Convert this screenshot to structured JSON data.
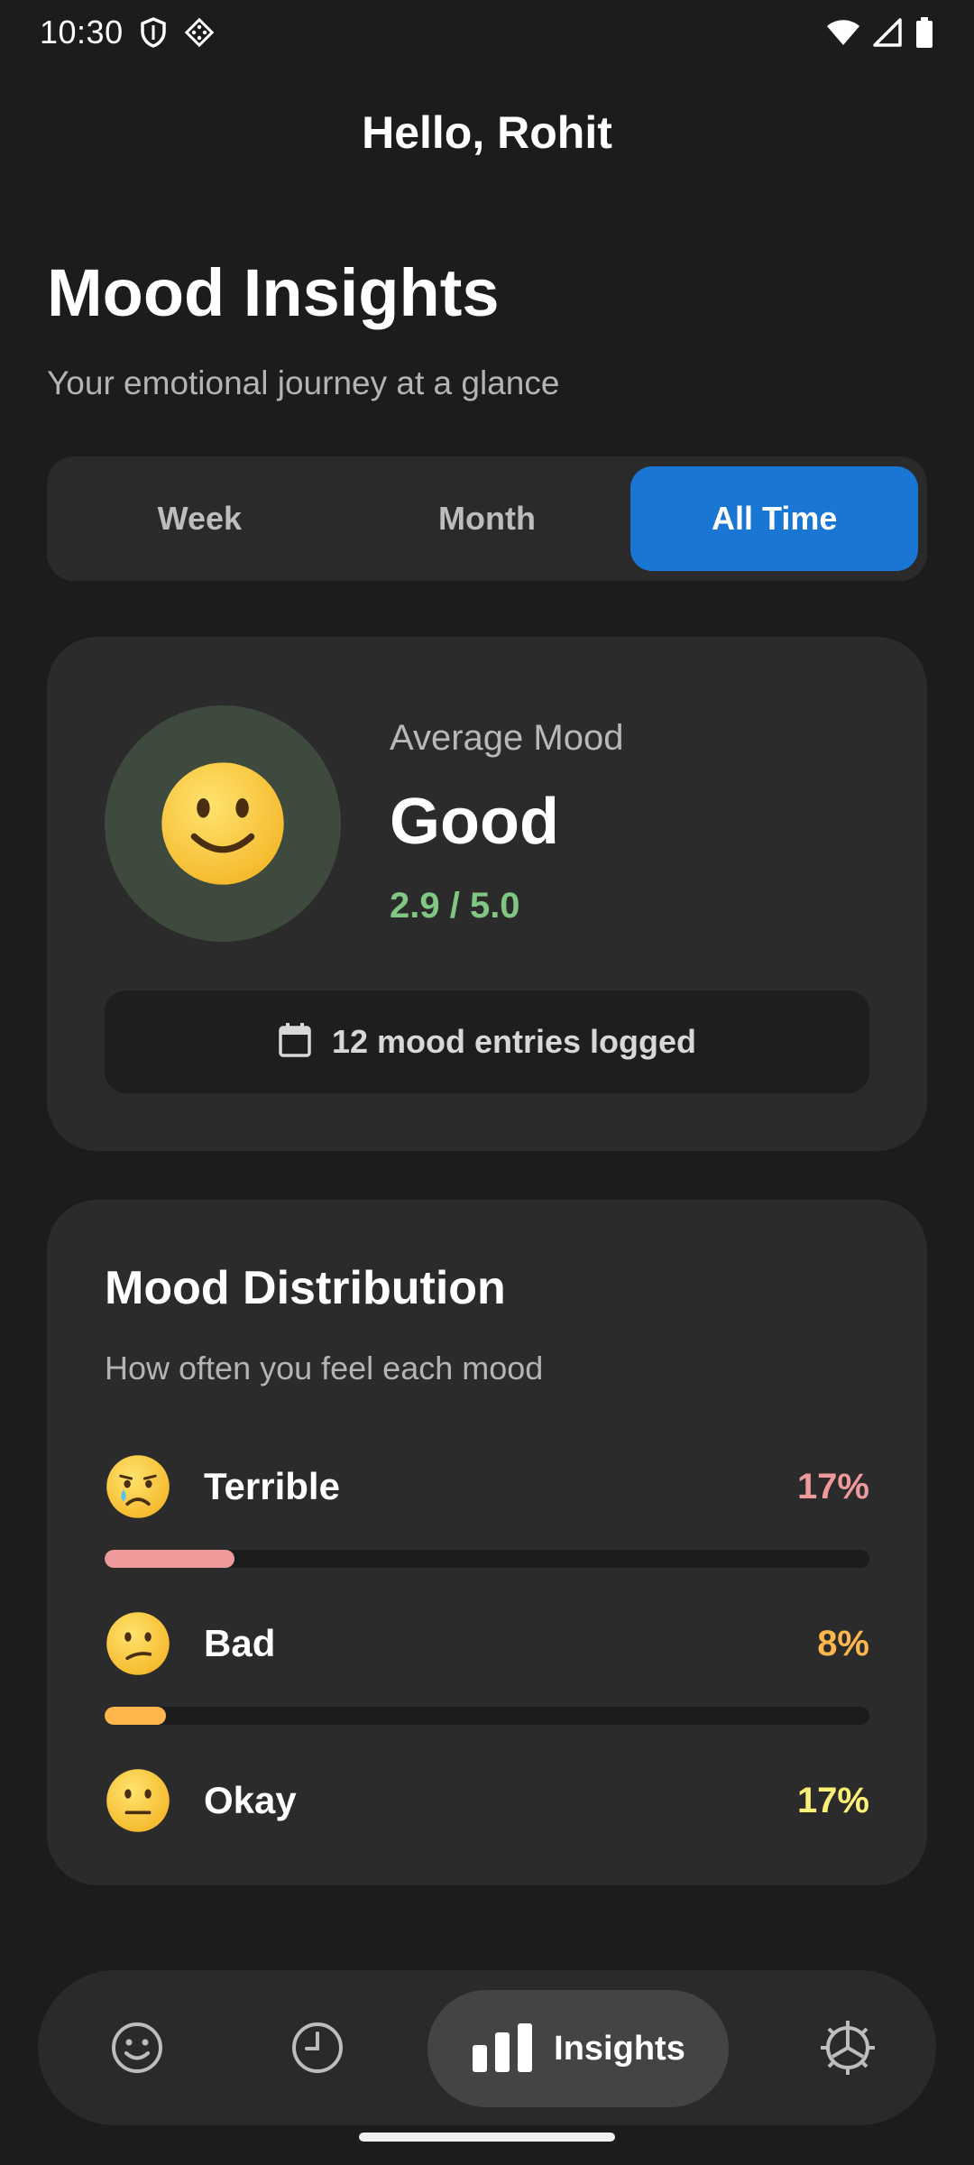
{
  "status_bar": {
    "time": "10:30",
    "icons": [
      "shield-icon",
      "diamond-grid-icon",
      "wifi-icon",
      "signal-icon",
      "battery-icon"
    ]
  },
  "header": {
    "greeting": "Hello, Rohit",
    "title": "Mood Insights",
    "subtitle": "Your emotional journey at a glance"
  },
  "period_tabs": {
    "options": [
      "Week",
      "Month",
      "All Time"
    ],
    "selected": "All Time"
  },
  "average_card": {
    "icon": "slightly-smiling-face",
    "label": "Average Mood",
    "value": "Good",
    "score": "2.9 / 5.0",
    "entries_icon": "calendar-icon",
    "entries_text": "12 mood entries logged"
  },
  "distribution": {
    "title": "Mood Distribution",
    "subtitle": "How often you feel each mood",
    "items": [
      {
        "name": "Terrible",
        "percent_label": "17%",
        "fraction": 0.17,
        "icon": "crying-face",
        "color": "#ef9a9a"
      },
      {
        "name": "Bad",
        "percent_label": "8%",
        "fraction": 0.08,
        "icon": "confused-face",
        "color": "#ffb74d"
      },
      {
        "name": "Okay",
        "percent_label": "17%",
        "fraction": 0.17,
        "icon": "neutral-face",
        "color": "#fff176"
      }
    ]
  },
  "bottom_nav": {
    "items": [
      {
        "icon": "smiley-icon"
      },
      {
        "icon": "history-clock-icon"
      },
      {
        "icon": "bar-chart-icon",
        "label": "Insights",
        "active": true
      },
      {
        "icon": "settings-gear-icon"
      }
    ]
  },
  "colors": {
    "background": "#1c1c1c",
    "card": "#2b2b2b",
    "accent": "#1976d2",
    "score_green": "#81c784"
  }
}
